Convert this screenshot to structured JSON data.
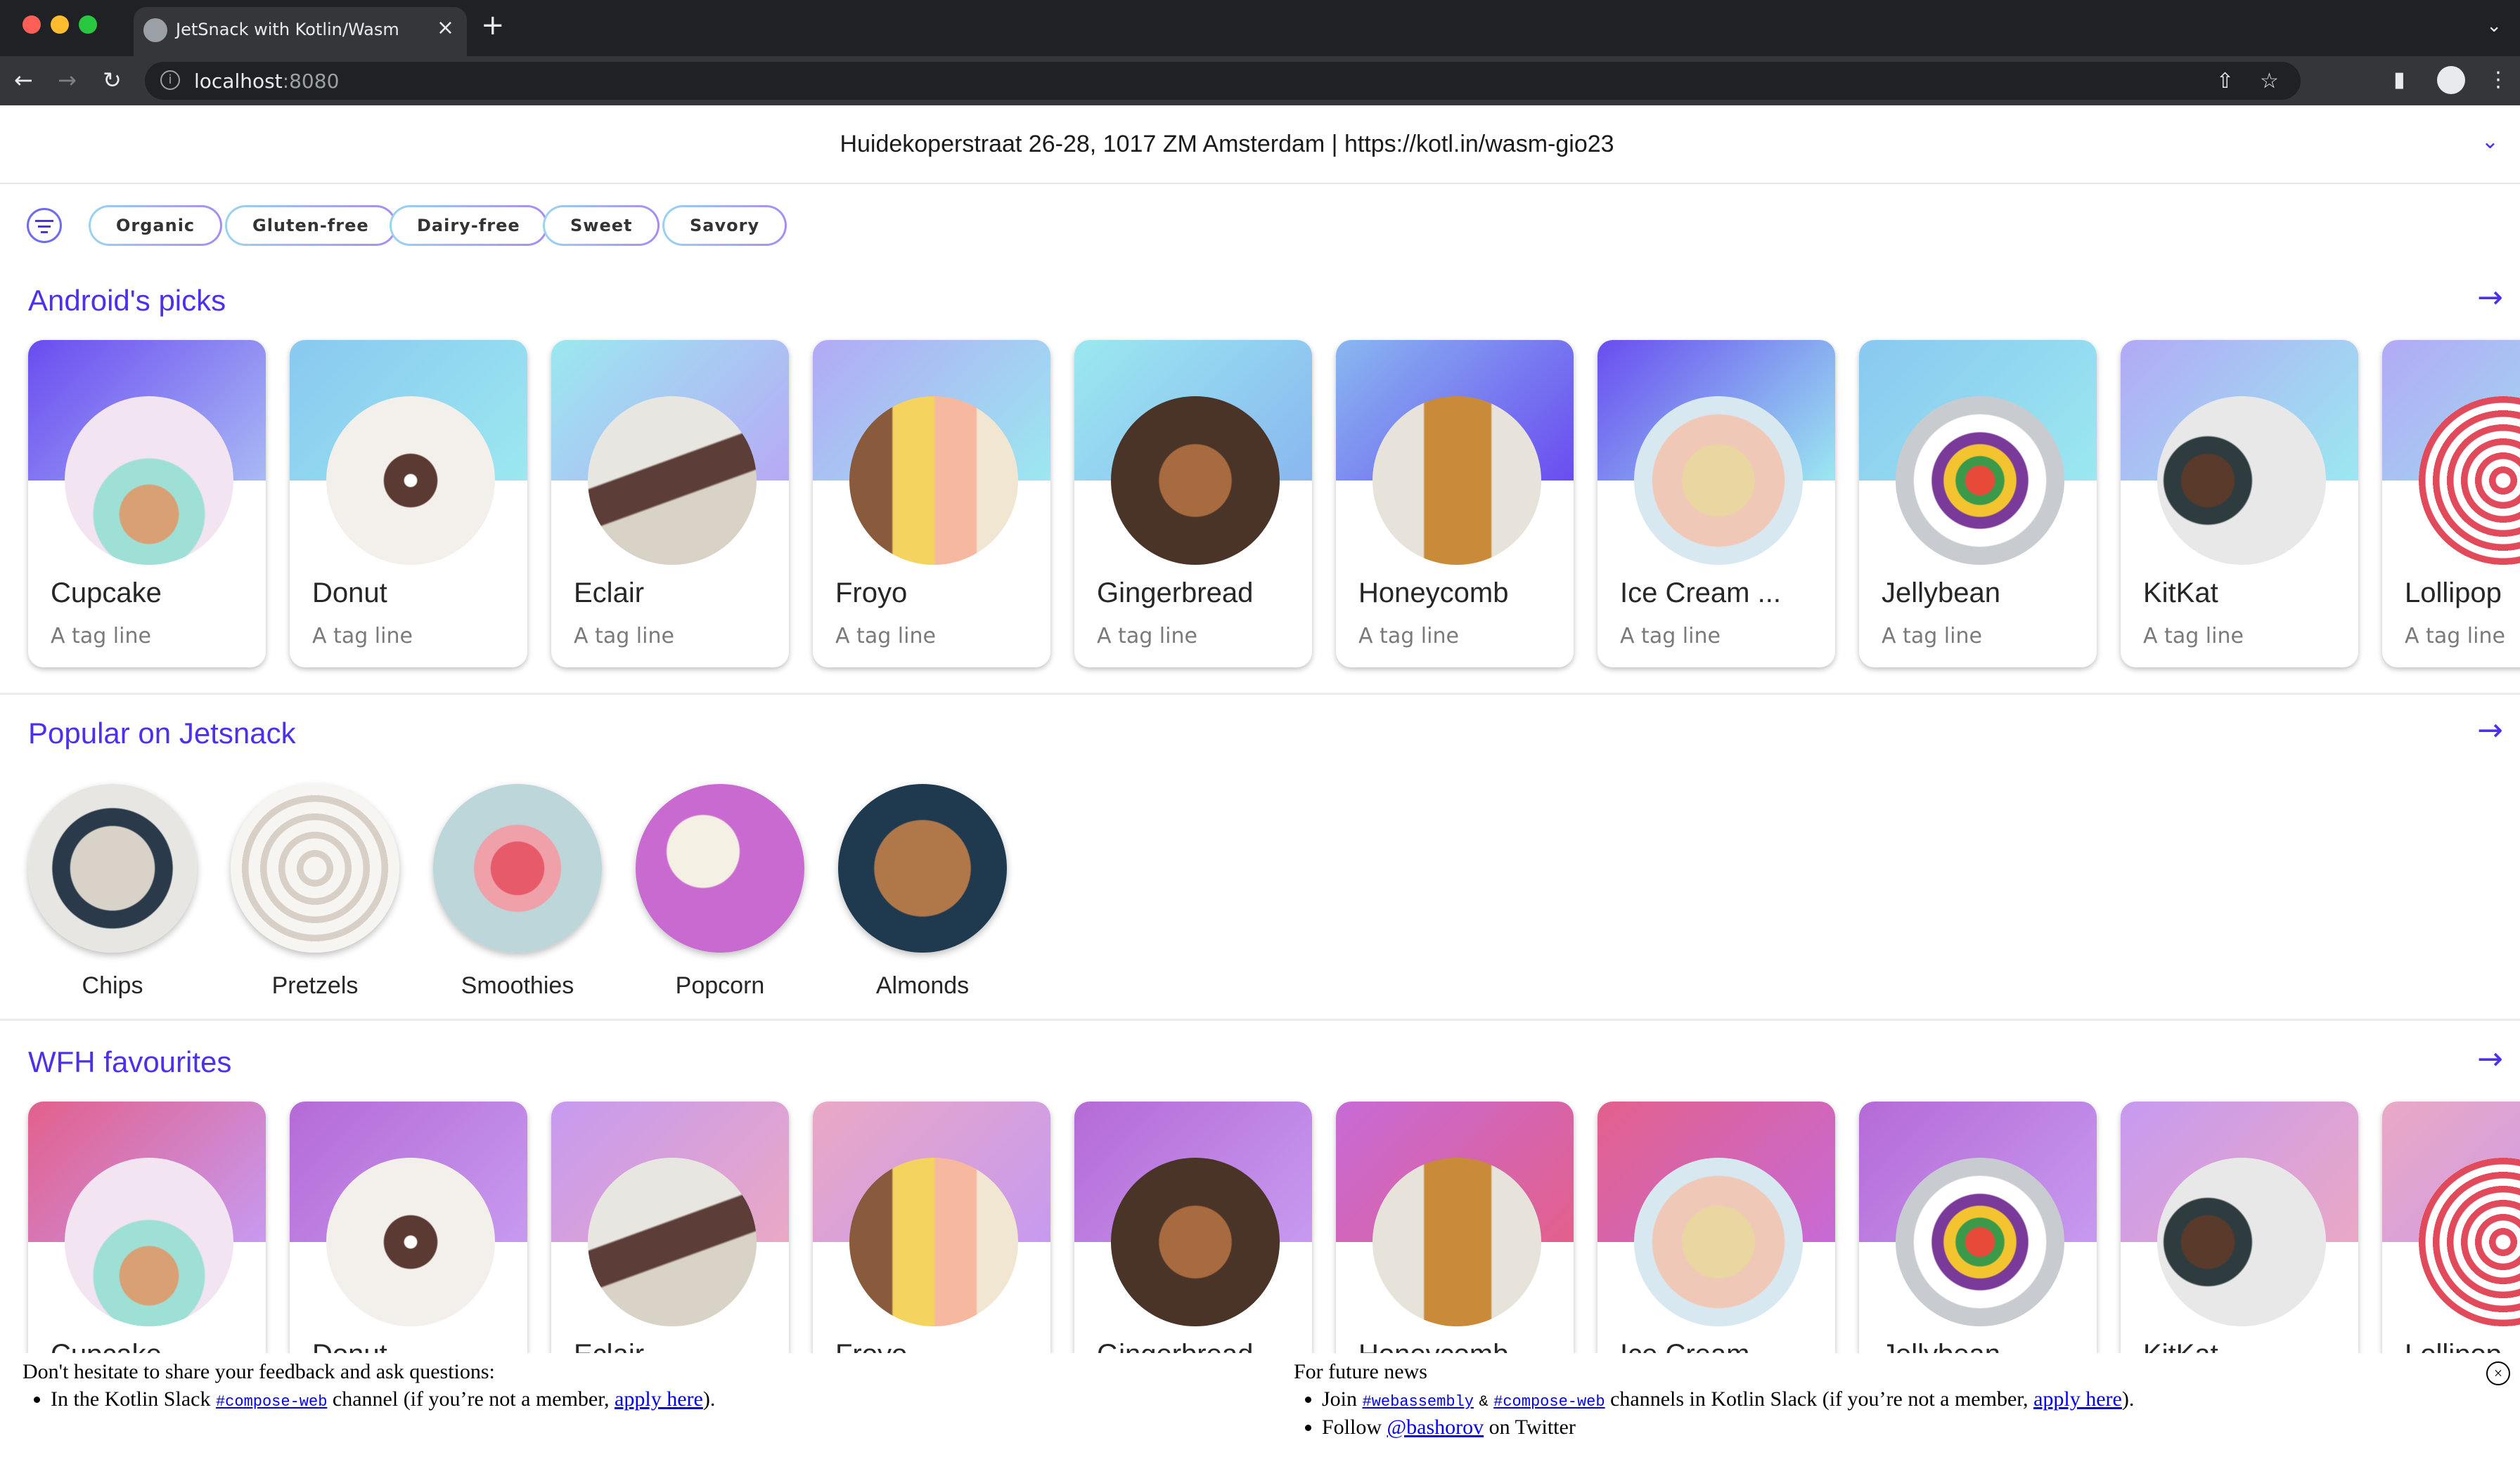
{
  "browser": {
    "tab_title": "JetSnack with Kotlin/Wasm",
    "url_host": "localhost",
    "url_port": ":8080"
  },
  "destination": {
    "text": "Huidekoperstraat 26-28, 1017 ZM Amsterdam | https://kotl.in/wasm-gio23"
  },
  "filters": [
    "Organic",
    "Gluten-free",
    "Dairy-free",
    "Sweet",
    "Savory"
  ],
  "sections": {
    "androids_picks": {
      "title": "Android's picks"
    },
    "popular": {
      "title": "Popular on Jetsnack"
    },
    "wfh": {
      "title": "WFH favourites"
    }
  },
  "snacks": [
    {
      "name": "Cupcake",
      "tagline": "A tag line"
    },
    {
      "name": "Donut",
      "tagline": "A tag line"
    },
    {
      "name": "Eclair",
      "tagline": "A tag line"
    },
    {
      "name": "Froyo",
      "tagline": "A tag line"
    },
    {
      "name": "Gingerbread",
      "tagline": "A tag line"
    },
    {
      "name": "Honeycomb",
      "tagline": "A tag line"
    },
    {
      "name": "Ice Cream ...",
      "tagline": "A tag line"
    },
    {
      "name": "Jellybean",
      "tagline": "A tag line"
    },
    {
      "name": "KitKat",
      "tagline": "A tag line"
    },
    {
      "name": "Lollipop",
      "tagline": "A tag line"
    }
  ],
  "popular_items": [
    {
      "name": "Chips"
    },
    {
      "name": "Pretzels"
    },
    {
      "name": "Smoothies"
    },
    {
      "name": "Popcorn"
    },
    {
      "name": "Almonds"
    }
  ],
  "wfh_items": [
    {
      "name": "Cupcake"
    },
    {
      "name": "Donut"
    },
    {
      "name": "Eclair"
    },
    {
      "name": "Froyo"
    },
    {
      "name": "Gingerbread"
    },
    {
      "name": "Honeycomb"
    },
    {
      "name": "Ice Cream ..."
    },
    {
      "name": "Jellybean"
    },
    {
      "name": "KitKat"
    },
    {
      "name": "Lollipop"
    }
  ],
  "feedback": {
    "left_heading": "Don't hesitate to share your feedback and ask questions:",
    "left_bullet_prefix": "In the Kotlin Slack",
    "left_channel": "#compose-web",
    "left_bullet_middle": "channel (if you’re not a member,",
    "left_apply": "apply here",
    "left_bullet_suffix": ").",
    "right_heading": "For future news",
    "right_join": "Join",
    "right_channel1": "#webassembly",
    "right_amp": "&",
    "right_channel2": "#compose-web",
    "right_middle": "channels in Kotlin Slack (if you’re not a member,",
    "right_apply": "apply here",
    "right_suffix": ").",
    "right_follow": "Follow",
    "right_handle": "@bashorov",
    "right_twitter": "on Twitter"
  },
  "colors": {
    "accent": "#4b30ed",
    "chrome_dark": "#202124",
    "chrome_toolbar": "#35363a"
  }
}
